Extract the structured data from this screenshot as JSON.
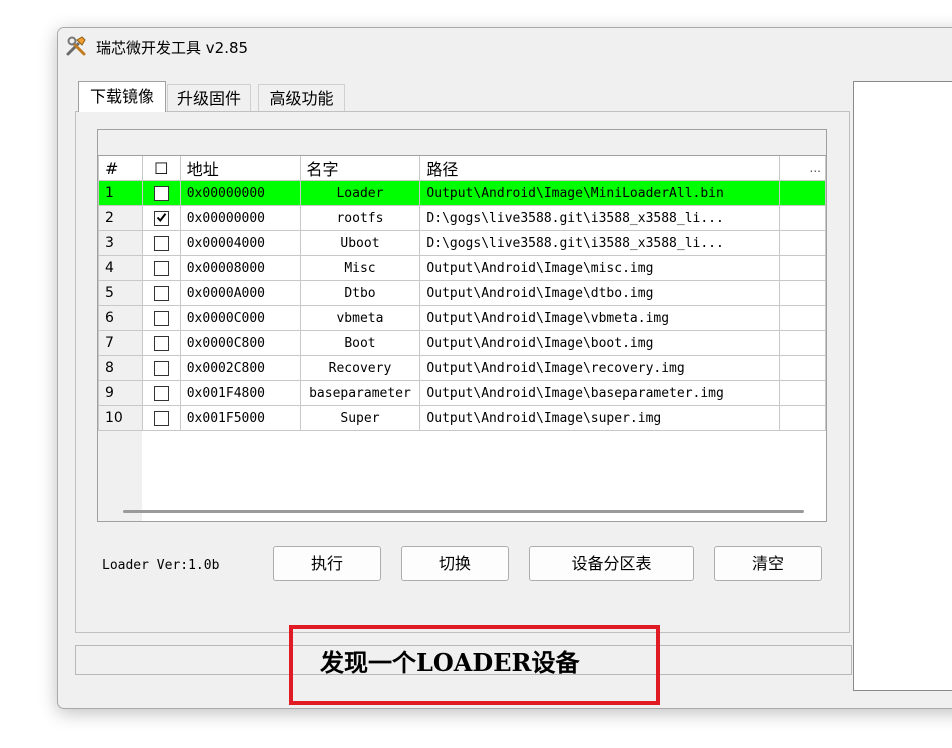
{
  "window": {
    "title": "瑞芯微开发工具 v2.85"
  },
  "tabs": [
    {
      "label": "下载镜像",
      "active": true
    },
    {
      "label": "升级固件",
      "active": false
    },
    {
      "label": "高级功能",
      "active": false
    }
  ],
  "table": {
    "headers": {
      "num": "#",
      "check": "☐",
      "address": "地址",
      "name": "名字",
      "path": "路径",
      "more": "..."
    },
    "rows": [
      {
        "num": "1",
        "checked": false,
        "address": "0x00000000",
        "name": "Loader",
        "path": "Output\\Android\\Image\\MiniLoaderAll.bin",
        "highlight": true
      },
      {
        "num": "2",
        "checked": true,
        "address": "0x00000000",
        "name": "rootfs",
        "path": "D:\\gogs\\live3588.git\\i3588_x3588_li..."
      },
      {
        "num": "3",
        "checked": false,
        "address": "0x00004000",
        "name": "Uboot",
        "path": "D:\\gogs\\live3588.git\\i3588_x3588_li..."
      },
      {
        "num": "4",
        "checked": false,
        "address": "0x00008000",
        "name": "Misc",
        "path": "Output\\Android\\Image\\misc.img"
      },
      {
        "num": "5",
        "checked": false,
        "address": "0x0000A000",
        "name": "Dtbo",
        "path": "Output\\Android\\Image\\dtbo.img"
      },
      {
        "num": "6",
        "checked": false,
        "address": "0x0000C000",
        "name": "vbmeta",
        "path": "Output\\Android\\Image\\vbmeta.img"
      },
      {
        "num": "7",
        "checked": false,
        "address": "0x0000C800",
        "name": "Boot",
        "path": "Output\\Android\\Image\\boot.img"
      },
      {
        "num": "8",
        "checked": false,
        "address": "0x0002C800",
        "name": "Recovery",
        "path": "Output\\Android\\Image\\recovery.img"
      },
      {
        "num": "9",
        "checked": false,
        "address": "0x001F4800",
        "name": "baseparameter",
        "path": "Output\\Android\\Image\\baseparameter.img"
      },
      {
        "num": "10",
        "checked": false,
        "address": "0x001F5000",
        "name": "Super",
        "path": "Output\\Android\\Image\\super.img"
      }
    ]
  },
  "footer": {
    "loader_ver": "Loader Ver:1.0b",
    "buttons": {
      "run": "执行",
      "switch": "切换",
      "partition_table": "设备分区表",
      "clear": "清空"
    }
  },
  "status": {
    "text": "发现一个LOADER设备",
    "highlight_color": "#e01b24"
  },
  "colors": {
    "highlight_row": "#00ff00"
  }
}
